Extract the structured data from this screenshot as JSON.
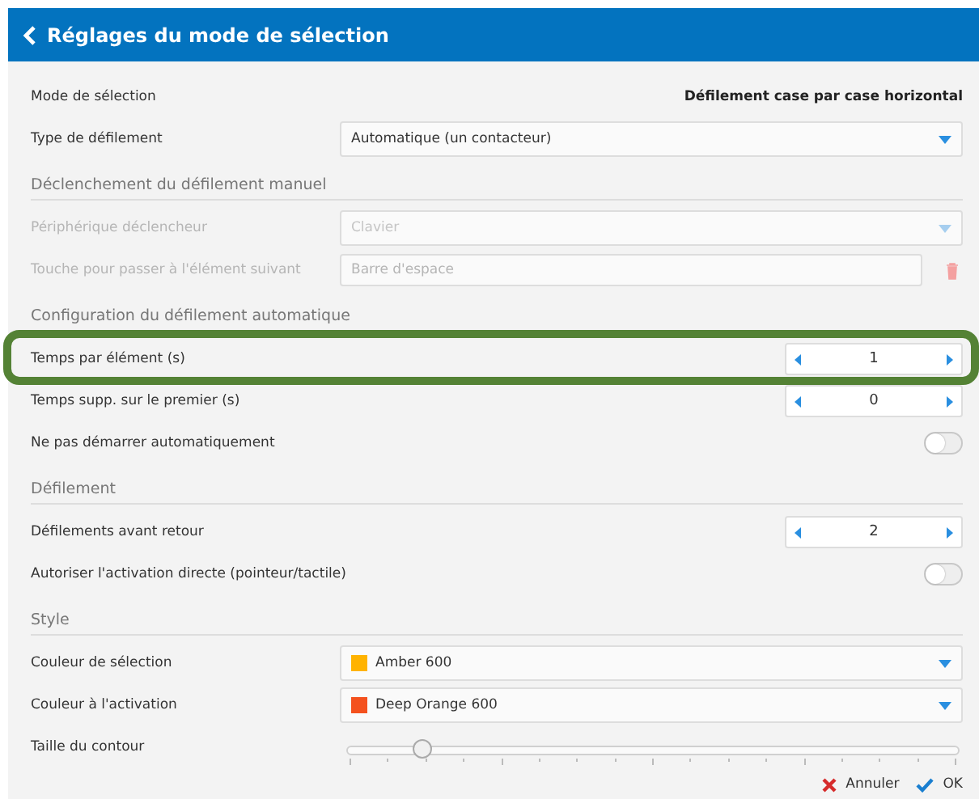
{
  "header": {
    "title": "Réglages du mode de sélection"
  },
  "sections": [
    {
      "disabled": false,
      "rows": [
        {
          "kind": "info",
          "label": "Mode de sélection",
          "value": "Défilement case par case horizontal"
        },
        {
          "kind": "select",
          "label": "Type de défilement",
          "value": "Automatique (un contacteur)"
        }
      ]
    },
    {
      "heading": "Déclenchement du défilement manuel",
      "disabled": true,
      "rows": [
        {
          "kind": "select",
          "label": "Périphérique déclencheur",
          "value": "Clavier"
        },
        {
          "kind": "text_input",
          "label": "Touche pour passer à l'élément suivant",
          "value": "Barre d'espace"
        }
      ]
    },
    {
      "heading": "Configuration du défilement automatique",
      "disabled": false,
      "rows": [
        {
          "kind": "spinner",
          "label": "Temps par élément (s)",
          "value": "1",
          "highlighted": true
        },
        {
          "kind": "spinner",
          "label": "Temps supp. sur le premier (s)",
          "value": "0",
          "highlighted": false
        },
        {
          "kind": "toggle",
          "label": "Ne pas démarrer automatiquement",
          "on": false
        }
      ]
    },
    {
      "heading": "Défilement",
      "disabled": false,
      "rows": [
        {
          "kind": "spinner",
          "label": "Défilements avant retour",
          "value": "2",
          "highlighted": false
        },
        {
          "kind": "toggle",
          "label": "Autoriser l'activation directe (pointeur/tactile)",
          "on": false
        }
      ]
    },
    {
      "heading": "Style",
      "disabled": false,
      "rows": [
        {
          "kind": "color_select",
          "label": "Couleur de sélection",
          "value": "Amber 600",
          "color": "#ffb300"
        },
        {
          "kind": "color_select",
          "label": "Couleur à l'activation",
          "value": "Deep Orange 600",
          "color": "#f4511e"
        },
        {
          "kind": "slider",
          "label": "Taille du contour",
          "level": 0.125
        }
      ]
    }
  ],
  "footer": [
    {
      "kind": "cancel",
      "label": "Annuler"
    },
    {
      "kind": "ok",
      "label": "OK"
    }
  ]
}
